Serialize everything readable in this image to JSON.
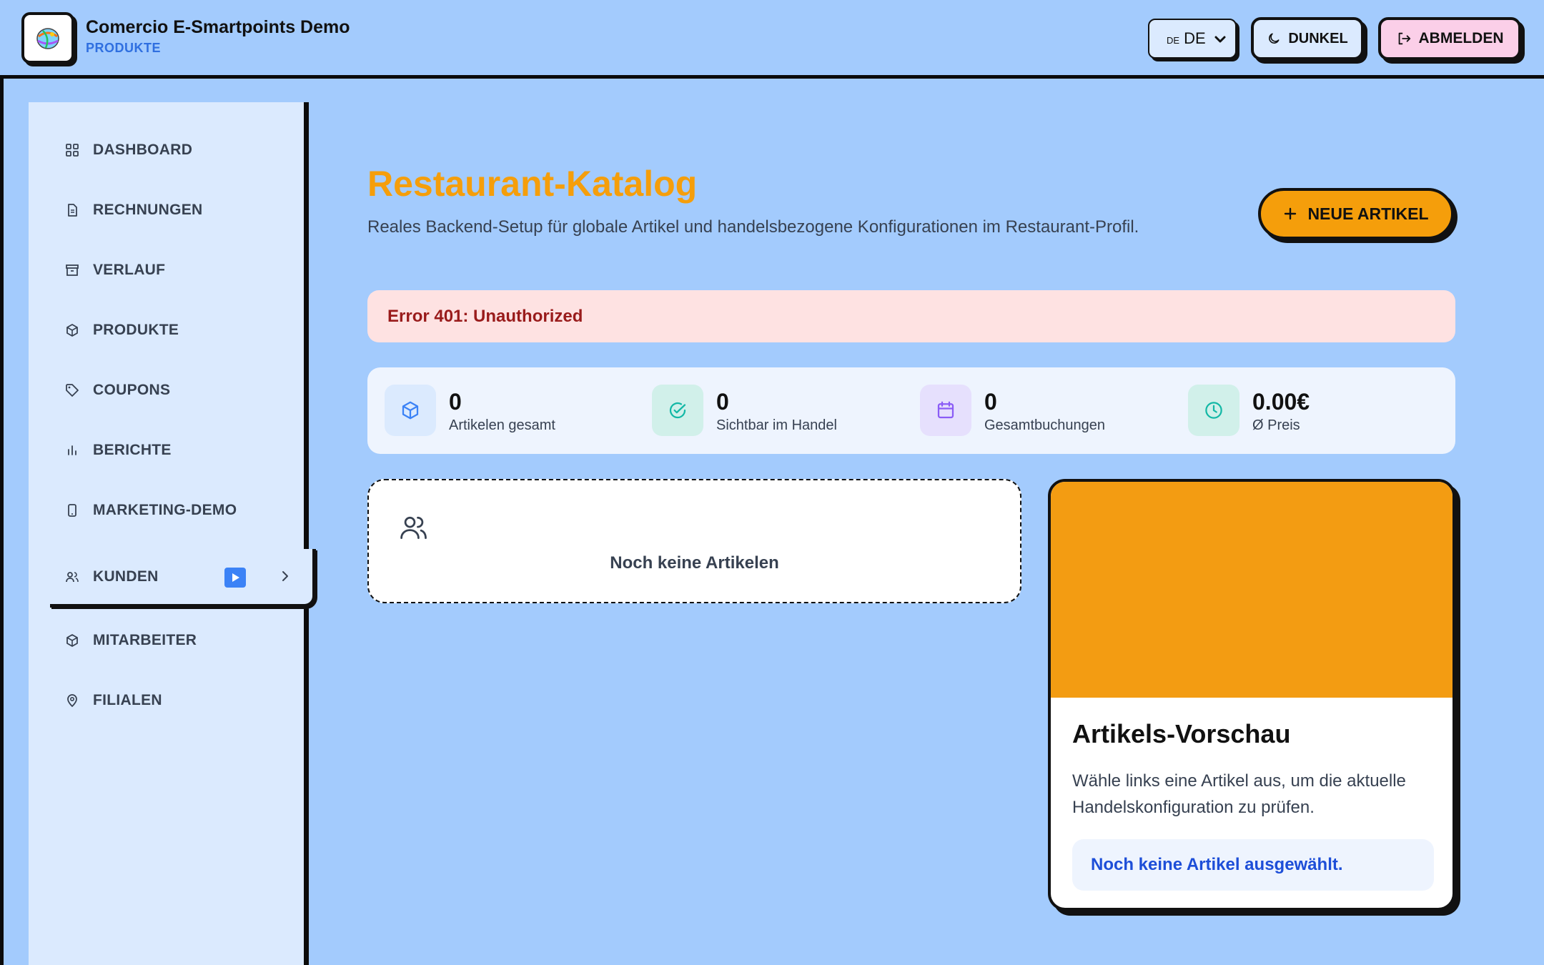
{
  "header": {
    "app_title": "Comercio E-Smartpoints Demo",
    "section": "PRODUKTE",
    "lang_code_small": "DE",
    "lang_value": "DE",
    "theme_label": "DUNKEL",
    "logout_label": "ABMELDEN"
  },
  "sidebar": {
    "items": [
      {
        "label": "DASHBOARD",
        "icon": "grid-icon"
      },
      {
        "label": "RECHNUNGEN",
        "icon": "document-icon"
      },
      {
        "label": "VERLAUF",
        "icon": "archive-icon"
      },
      {
        "label": "PRODUKTE",
        "icon": "box-icon"
      },
      {
        "label": "COUPONS",
        "icon": "tag-icon"
      },
      {
        "label": "BERICHTE",
        "icon": "bar-chart-icon"
      },
      {
        "label": "MARKETING-DEMO",
        "icon": "tablet-icon"
      },
      {
        "label": "KUNDEN",
        "icon": "users-icon",
        "active": true
      },
      {
        "label": "MITARBEITER",
        "icon": "box-icon"
      },
      {
        "label": "FILIALEN",
        "icon": "map-pin-icon"
      }
    ]
  },
  "main": {
    "title": "Restaurant-Katalog",
    "description": "Reales Backend-Setup für globale Artikel und handelsbezogene Konfigurationen im Restaurant-Profil.",
    "new_button": "NEUE ARTIKEL",
    "error": "Error 401: Unauthorized",
    "stats": [
      {
        "value": "0",
        "label": "Artikelen gesamt",
        "icon": "cube-icon",
        "color": "#3b82f6"
      },
      {
        "value": "0",
        "label": "Sichtbar im Handel",
        "icon": "check-circle-icon",
        "color": "#14b8a6"
      },
      {
        "value": "0",
        "label": "Gesamtbuchungen",
        "icon": "calendar-icon",
        "color": "#8b5cf6"
      },
      {
        "value": "0.00€",
        "label": "Ø Preis",
        "icon": "clock-icon",
        "color": "#14b8a6"
      }
    ],
    "empty_text": "Noch keine Artikelen",
    "preview": {
      "title": "Artikels-Vorschau",
      "description": "Wähle links eine Artikel aus, um die aktuelle Handelskonfiguration zu prüfen.",
      "note": "Noch keine Artikel ausgewählt."
    }
  },
  "colors": {
    "background": "#a3cbfd",
    "accent": "#f59e0b",
    "sidebar": "#dbeafe",
    "error_bg": "#fee2e2",
    "error_text": "#991b1b",
    "link": "#1d4ed8"
  }
}
